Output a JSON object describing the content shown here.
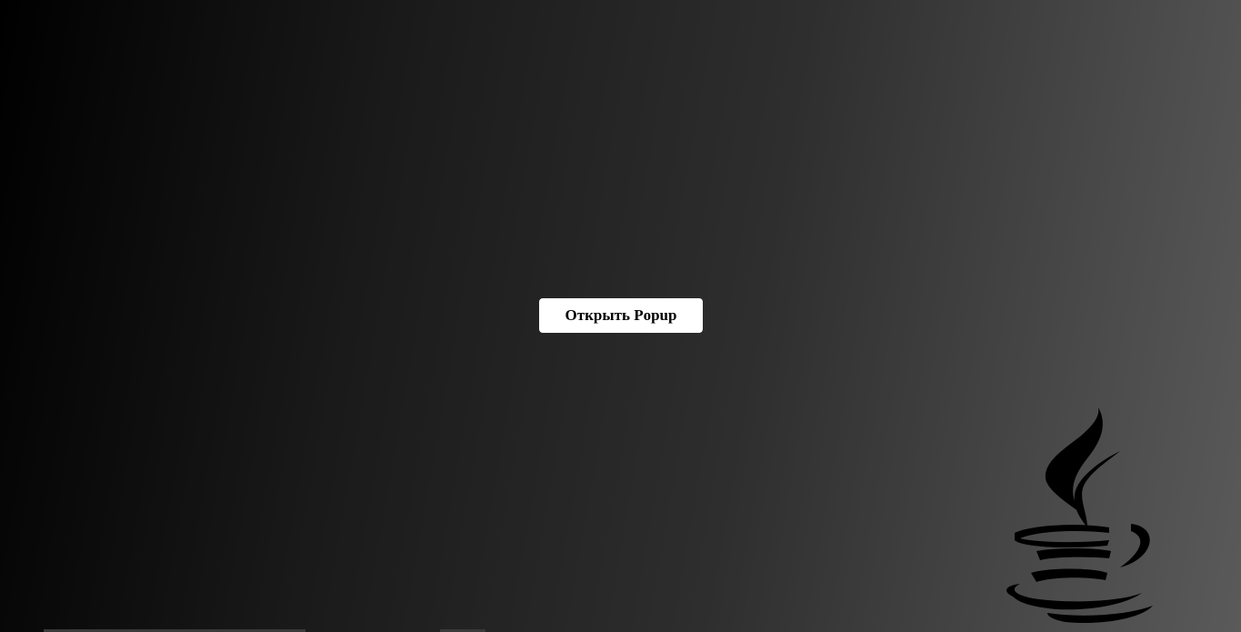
{
  "popup_trigger": {
    "label": "Открыть Popup"
  },
  "background": {
    "gradient_start": "#000000",
    "gradient_end": "#5a5a5a"
  },
  "icons": {
    "logo": "java-coffee-cup-icon"
  },
  "colors": {
    "button_bg": "#ffffff",
    "button_text": "#000000",
    "logo": "#000000"
  }
}
